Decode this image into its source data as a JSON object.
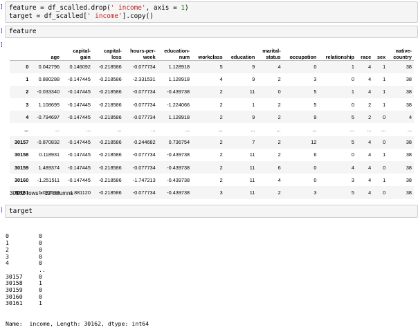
{
  "cells": {
    "cell1": {
      "line1": {
        "pre": "feature = df_scalled.drop(",
        "s1": "' income'",
        "mid": ", axis = ",
        "n1": "1",
        "post": ")"
      },
      "line2": {
        "pre": "target = df_scalled[",
        "s1": "' income'",
        "post": "].copy()"
      }
    },
    "cell2": {
      "code": "feature"
    },
    "cell3": {
      "code": "target"
    }
  },
  "dataframe": {
    "columns": [
      "age",
      "capital-\ngain",
      "capital-\nloss",
      "hours-per-\nweek",
      "education-\nnum",
      "workclass",
      "education",
      "marital-\nstatus",
      "occupation",
      "relationship",
      "race",
      "sex",
      "native-\ncountry"
    ],
    "rows": [
      {
        "index": "0",
        "cells": [
          "0.042796",
          "0.146092",
          "-0.218586",
          "-0.077734",
          "1.128918",
          "5",
          "9",
          "4",
          "0",
          "1",
          "4",
          "1",
          "38"
        ]
      },
      {
        "index": "1",
        "cells": [
          "0.880288",
          "-0.147445",
          "-0.218586",
          "-2.331531",
          "1.128918",
          "4",
          "9",
          "2",
          "3",
          "0",
          "4",
          "1",
          "38"
        ]
      },
      {
        "index": "2",
        "cells": [
          "-0.033340",
          "-0.147445",
          "-0.218586",
          "-0.077734",
          "-0.439738",
          "2",
          "11",
          "0",
          "5",
          "1",
          "4",
          "1",
          "38"
        ]
      },
      {
        "index": "3",
        "cells": [
          "1.108695",
          "-0.147445",
          "-0.218586",
          "-0.077734",
          "-1.224066",
          "2",
          "1",
          "2",
          "5",
          "0",
          "2",
          "1",
          "38"
        ]
      },
      {
        "index": "4",
        "cells": [
          "-0.794697",
          "-0.147445",
          "-0.218586",
          "-0.077734",
          "1.128918",
          "2",
          "9",
          "2",
          "9",
          "5",
          "2",
          "0",
          "4"
        ]
      },
      {
        "index": "...",
        "cells": [
          "...",
          "...",
          "...",
          "...",
          "...",
          "...",
          "...",
          "...",
          "...",
          "...",
          "...",
          "...",
          "..."
        ]
      },
      {
        "index": "30157",
        "cells": [
          "-0.870832",
          "-0.147445",
          "-0.218586",
          "-0.244682",
          "0.736754",
          "2",
          "7",
          "2",
          "12",
          "5",
          "4",
          "0",
          "38"
        ]
      },
      {
        "index": "30158",
        "cells": [
          "0.118931",
          "-0.147445",
          "-0.218586",
          "-0.077734",
          "-0.439738",
          "2",
          "11",
          "2",
          "6",
          "0",
          "4",
          "1",
          "38"
        ]
      },
      {
        "index": "30159",
        "cells": [
          "1.489374",
          "-0.147445",
          "-0.218586",
          "-0.077734",
          "-0.439738",
          "2",
          "11",
          "6",
          "0",
          "4",
          "4",
          "0",
          "38"
        ]
      },
      {
        "index": "30160",
        "cells": [
          "-1.251511",
          "-0.147445",
          "-0.218586",
          "-1.747213",
          "-0.439738",
          "2",
          "11",
          "4",
          "0",
          "3",
          "4",
          "1",
          "38"
        ]
      },
      {
        "index": "30161",
        "cells": [
          "1.032559",
          "1.881120",
          "-0.218586",
          "-0.077734",
          "-0.439738",
          "3",
          "11",
          "2",
          "3",
          "5",
          "4",
          "0",
          "38"
        ]
      }
    ],
    "shape_text": "30162 rows × 13 columns"
  },
  "series": {
    "rows": [
      {
        "idx": "0",
        "val": "0"
      },
      {
        "idx": "1",
        "val": "0"
      },
      {
        "idx": "2",
        "val": "0"
      },
      {
        "idx": "3",
        "val": "0"
      },
      {
        "idx": "4",
        "val": "0"
      },
      {
        "idx": "",
        "val": ".."
      },
      {
        "idx": "30157",
        "val": "0"
      },
      {
        "idx": "30158",
        "val": "1"
      },
      {
        "idx": "30159",
        "val": "0"
      },
      {
        "idx": "30160",
        "val": "0"
      },
      {
        "idx": "30161",
        "val": "1"
      }
    ],
    "footer": "Name:  income, Length: 30162, dtype: int64"
  },
  "colors": {
    "string": "#ba2121",
    "number": "#008000",
    "cell_bg": "#f5f5f5"
  }
}
